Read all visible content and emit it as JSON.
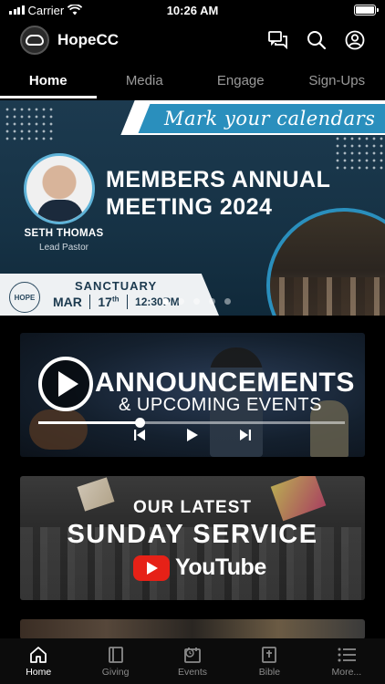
{
  "status_bar": {
    "carrier": "Carrier",
    "time": "10:26 AM"
  },
  "header": {
    "app_title": "HopeCC",
    "icons": [
      "chat-icon",
      "search-icon",
      "account-icon"
    ]
  },
  "tabs": [
    {
      "label": "Home",
      "active": true
    },
    {
      "label": "Media",
      "active": false
    },
    {
      "label": "Engage",
      "active": false
    },
    {
      "label": "Sign-Ups",
      "active": false
    }
  ],
  "hero": {
    "script_text": "Mark your calendars",
    "headline_line1": "MEMBERS ANNUAL",
    "headline_line2": "MEETING 2024",
    "pastor_name": "SETH THOMAS",
    "pastor_role": "Lead Pastor",
    "logo_text": "HOPE",
    "location": "SANCTUARY",
    "month": "MAR",
    "day": "17",
    "day_suffix": "th",
    "time": "12:30PM",
    "carousel": {
      "total": 5,
      "active_index": 0
    }
  },
  "cards": {
    "announcements": {
      "title": "ANNOUNCEMENTS",
      "subtitle": "& UPCOMING EVENTS",
      "progress": 0.33
    },
    "sunday": {
      "line1": "OUR LATEST",
      "line2": "SUNDAY SERVICE",
      "brand": "YouTube"
    }
  },
  "bottom_nav": [
    {
      "label": "Home",
      "icon": "home-icon",
      "active": true
    },
    {
      "label": "Giving",
      "icon": "giving-icon",
      "active": false
    },
    {
      "label": "Events",
      "icon": "events-icon",
      "active": false
    },
    {
      "label": "Bible",
      "icon": "bible-icon",
      "active": false
    },
    {
      "label": "More...",
      "icon": "more-icon",
      "active": false
    }
  ],
  "colors": {
    "accent_blue": "#2a8fbd",
    "hero_bg": "#1c3a4f",
    "youtube_red": "#e62117"
  }
}
